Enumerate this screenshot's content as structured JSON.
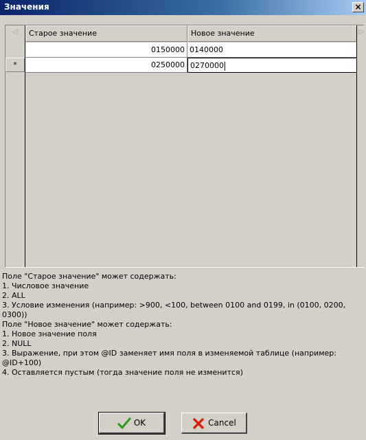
{
  "window": {
    "title": "Значения",
    "close_glyph": "×"
  },
  "grid": {
    "columns": [
      "Старое значение",
      "Новое значение"
    ],
    "rows": [
      {
        "old": "0150000",
        "new": "0140000"
      },
      {
        "old": "0250000",
        "new": "0270000"
      }
    ],
    "current_row_indicator": "*",
    "left_arrow": "◁",
    "right_arrow": "▷"
  },
  "help_text": [
    "Поле \"Старое значение\" может содержать:",
    "1. Числовое значение",
    "2. ALL",
    "3. Условие изменения (например: >900, <100, between 0100 and 0199, in (0100, 0200, 0300))",
    "Поле \"Новое значение\" может содержать:",
    "1. Новое значение поля",
    "2. NULL",
    "3. Выражение, при этом @ID заменяет имя поля в изменяемой таблице (например: @ID+100)",
    "4. Оставляется пустым (тогда значение поля не изменится)"
  ],
  "buttons": {
    "ok_label": "OK",
    "cancel_label": "Cancel",
    "ok_icon": "checkmark-icon",
    "cancel_icon": "cross-icon"
  },
  "colors": {
    "titlebar_start": "#0a246a",
    "titlebar_end": "#a6caf0",
    "window_bg": "#d4d0c8",
    "ok_icon": "#2e9c1e",
    "cancel_icon": "#d42010"
  }
}
